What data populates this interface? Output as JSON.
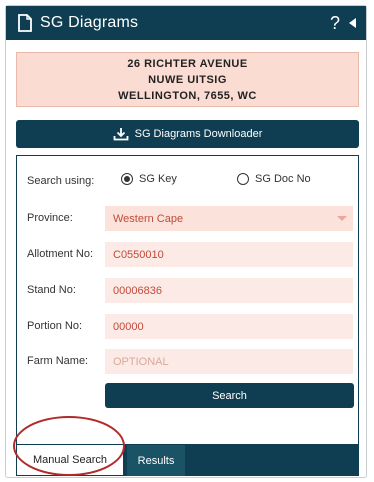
{
  "header": {
    "title": "SG Diagrams",
    "help_icon": "question-icon",
    "collapse_icon": "caret-left-icon",
    "doc_icon": "document-icon"
  },
  "address": {
    "line1": "26 RICHTER AVENUE",
    "line2": "NUWE UITSIG",
    "line3": "WELLINGTON, 7655, WC"
  },
  "downloader": {
    "label": "SG Diagrams Downloader",
    "icon": "download-icon"
  },
  "form": {
    "search_using_label": "Search using:",
    "radio_sg_key": "SG Key",
    "radio_sg_doc": "SG Doc No",
    "selected_radio": "SG Key",
    "province_label": "Province:",
    "province_value": "Western Cape",
    "allotment_label": "Allotment No:",
    "allotment_value": "C0550010",
    "stand_label": "Stand No:",
    "stand_value": "00006836",
    "portion_label": "Portion No:",
    "portion_value": "00000",
    "farm_label": "Farm Name:",
    "farm_placeholder": "OPTIONAL",
    "search_button": "Search"
  },
  "tabs": {
    "manual": "Manual Search",
    "results": "Results"
  },
  "colors": {
    "primary": "#0f3e52",
    "address_bg": "#fadcd3",
    "field_bg": "#fbeae5",
    "field_text": "#c44a3a",
    "highlight": "#b22a2a"
  }
}
